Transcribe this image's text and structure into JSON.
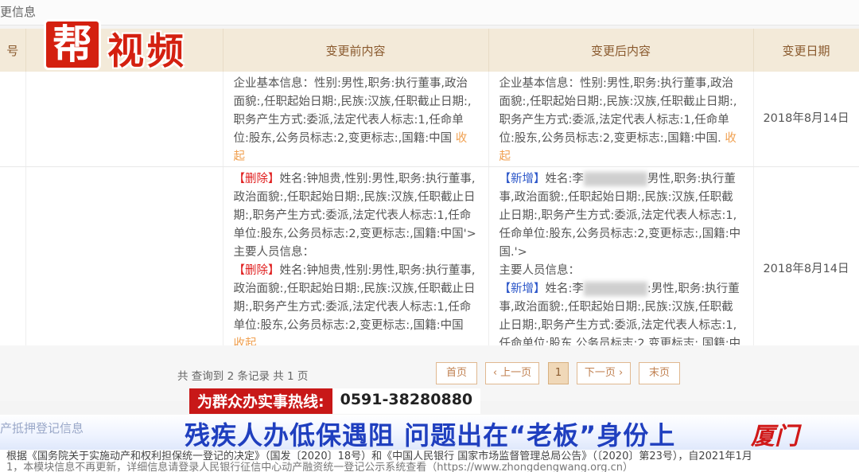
{
  "section_title": "更信息",
  "table": {
    "headers": [
      "号",
      "",
      "变更前内容",
      "变更后内容",
      "变更日期"
    ],
    "row1": {
      "before": "企业基本信息：性别:男性,职务:执行董事,政治面貌:,任职起始日期:,民族:汉族,任职截止日期:,职务产生方式:委派,法定代表人标志:1,任命单位:股东,公务员标志:2,变更标志:,国籍:中国",
      "after": "企业基本信息：性别:男性,职务:执行董事,政治面貌:,任职起始日期:,民族:汉族,任职截止日期:,职务产生方式:委派,法定代表人标志:1,任命单位:股东,公务员标志:2,变更标志:,国籍:中国.",
      "date": "2018年8月14日"
    },
    "row2": {
      "before_tag": "【删除】",
      "before_p1": "姓名:钟旭贵,性别:男性,职务:执行董事,政治面貌:,任职起始日期:,民族:汉族,任职截止日期:,职务产生方式:委派,法定代表人标志:1,任命单位:股东,公务员标志:2,变更标志:,国籍:中国'>",
      "mid_label": "主要人员信息：",
      "before_p2": "姓名:钟旭贵,性别:男性,职务:执行董事,政治面貌:,任职起始日期:,民族:汉族,任职截止日期:,职务产生方式:委派,法定代表人标志:1,任命单位:股东,公务员标志:2,变更标志:,国籍:中国",
      "after_tag": "【新增】",
      "after_name": "姓名:李",
      "after_p1": "男性,职务:执行董事,政治面貌:,任职起始日期:,民族:汉族,任职截止日期:,职务产生方式:委派,法定代表人标志:1,任命单位:股东,公务员标志:2,变更标志:,国籍:中国.'>",
      "after_p2": ":男性,职务:执行董事,政治面貌:,任职起始日期:,民族:汉族,任职截止日期:,职务产生方式:委派,法定代表人标志:1,任命单位:股东,公务员标志:2,变更标志:,国籍:中国.",
      "date": "2018年8月14日"
    },
    "collapse_label": "收起"
  },
  "pager": {
    "info": "共 查询到 2 条记录 共 1 页",
    "first": "首页",
    "prev": "‹ 上一页",
    "current": "1",
    "next": "下一页 ›",
    "last": "末页"
  },
  "logo": {
    "box": "帮",
    "text": "视频"
  },
  "hotline": {
    "label": "为群众办实事热线:",
    "number": "0591-38280880"
  },
  "headline": {
    "bg_text": "产抵押登记信息",
    "text": "残疾人办低保遇阻 问题出在“老板”身份上",
    "location": "厦门"
  },
  "footnote": {
    "line1": "根据《国务院关于实施动产和权利担保统一登记的决定》（国发〔2020〕18号）和《中国人民银行 国家市场监督管理总局公告》（〔2020〕第23号），自2021年1月",
    "line2": "1，本模块信息不再更新，详细信息请登录人民银行征信中心动产融资统一登记公示系统查看（https://www.zhongdengwang.org.cn）"
  },
  "colors": {
    "accent": "#c81818",
    "headline": "#1f3fbf",
    "header_bg": "#f3ead9"
  }
}
